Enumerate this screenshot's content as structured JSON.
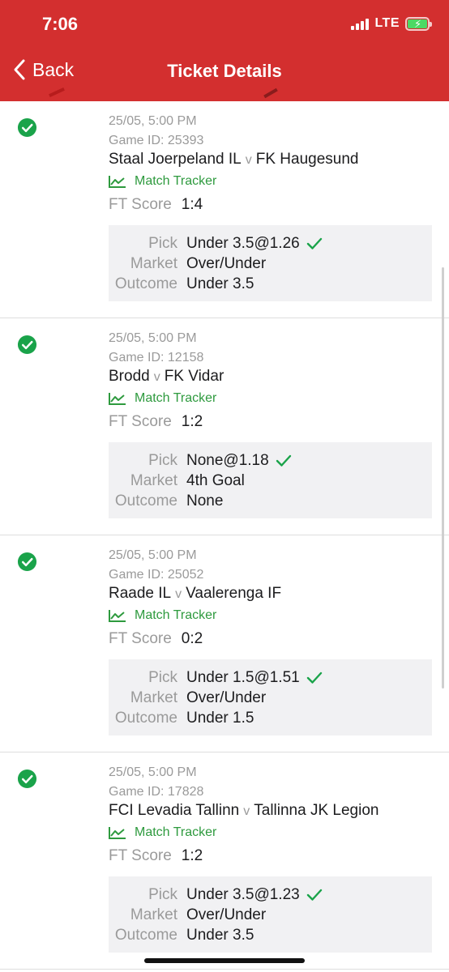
{
  "status_bar": {
    "time": "7:06",
    "network": "LTE"
  },
  "nav": {
    "back_label": "Back",
    "title": "Ticket Details"
  },
  "colors": {
    "brand": "#d32f2f",
    "success": "#2e9a3e",
    "check": "#1aa34a"
  },
  "labels": {
    "match_tracker": "Match Tracker",
    "ft_score": "FT Score",
    "pick": "Pick",
    "market": "Market",
    "outcome": "Outcome",
    "versus": "v"
  },
  "items": [
    {
      "date": "25/05, 5:00 PM",
      "game_id": "Game ID: 25393",
      "home": "Staal Joerpeland IL",
      "away": "FK Haugesund",
      "ft_score": "1:4",
      "pick": "Under 3.5@1.26",
      "market": "Over/Under",
      "outcome": "Under 3.5"
    },
    {
      "date": "25/05, 5:00 PM",
      "game_id": "Game ID: 12158",
      "home": "Brodd",
      "away": "FK Vidar",
      "ft_score": "1:2",
      "pick": "None@1.18",
      "market": "4th Goal",
      "outcome": "None"
    },
    {
      "date": "25/05, 5:00 PM",
      "game_id": "Game ID: 25052",
      "home": "Raade IL",
      "away": "Vaalerenga IF",
      "ft_score": "0:2",
      "pick": "Under 1.5@1.51",
      "market": "Over/Under",
      "outcome": "Under 1.5"
    },
    {
      "date": "25/05, 5:00 PM",
      "game_id": "Game ID: 17828",
      "home": "FCI Levadia Tallinn",
      "away": "Tallinna JK Legion",
      "ft_score": "1:2",
      "pick": "Under 3.5@1.23",
      "market": "Over/Under",
      "outcome": "Under 3.5"
    }
  ]
}
